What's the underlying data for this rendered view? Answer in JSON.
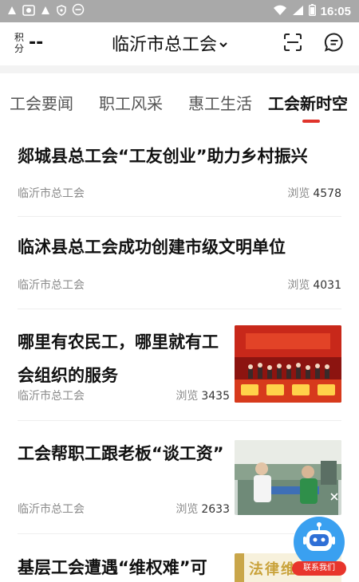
{
  "status_bar": {
    "time": "16:05",
    "icons": [
      "notification-icon",
      "photo-icon",
      "notification-icon",
      "shield-icon",
      "minus-circle-icon",
      "wifi-icon",
      "signal-icon",
      "battery-icon"
    ]
  },
  "header": {
    "points_label": "积分",
    "points_value": "--",
    "title": "临沂市总工会",
    "title_icon": "chevron-down-icon",
    "scan_icon": "scan-icon",
    "message_icon": "message-icon"
  },
  "tabs": [
    {
      "label": "工会要闻",
      "active": false
    },
    {
      "label": "职工风采",
      "active": false
    },
    {
      "label": "惠工生活",
      "active": false
    },
    {
      "label": "工会新时空",
      "active": true
    }
  ],
  "accent_color": "#e0342c",
  "views_label": "浏览",
  "news": [
    {
      "title": "郯城县总工会“工友创业”助力乡村振兴",
      "source": "临沂市总工会",
      "views": "4578",
      "has_image": false
    },
    {
      "title": "临沭县总工会成功创建市级文明单位",
      "source": "临沂市总工会",
      "views": "4031",
      "has_image": false
    },
    {
      "title": "哪里有农民工，哪里就有工会组织的服务",
      "source": "临沂市总工会",
      "views": "3435",
      "has_image": true,
      "image_icon": "stage-event-photo"
    },
    {
      "title": "工会帮职工跟老板“谈工资”",
      "source": "临沂市总工会",
      "views": "2633",
      "has_image": true,
      "image_icon": "factory-workers-photo"
    },
    {
      "title": "基层工会遭遇“维权难”可",
      "source": "",
      "views": "",
      "has_image": true,
      "image_icon": "legal-banner-photo",
      "image_text": "法律维权"
    }
  ],
  "fab": {
    "label": "联系我们",
    "icon": "robot-icon"
  }
}
